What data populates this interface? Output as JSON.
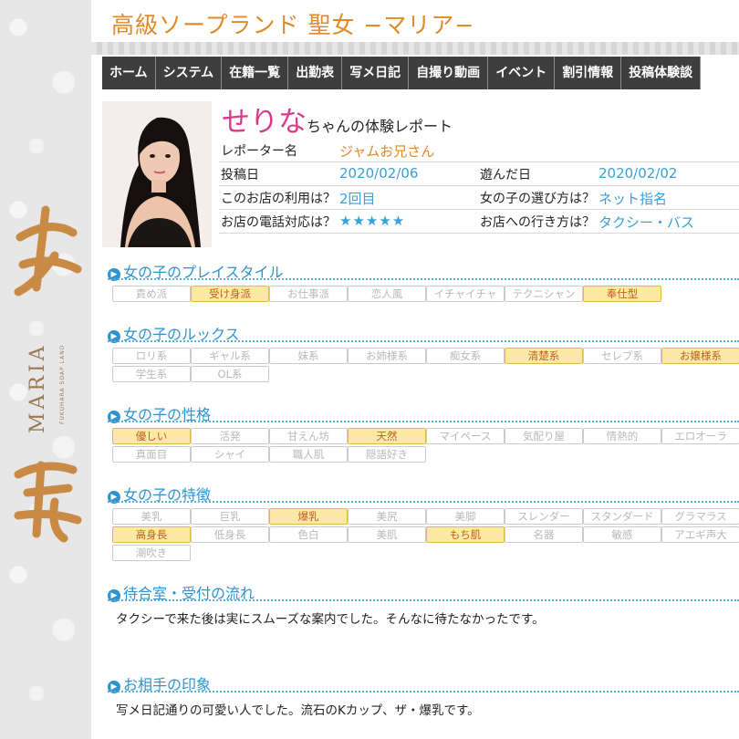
{
  "site": {
    "title": "高級ソープランド 聖女 −マリア−",
    "logo_text": "MARIA",
    "logo_subtext": "FUKUHARA SOAP LAND",
    "logo_kanji": "聖 女"
  },
  "nav": [
    "ホーム",
    "システム",
    "在籍一覧",
    "出勤表",
    "写メ日記",
    "自撮り動画",
    "イベント",
    "割引情報",
    "投稿体験談"
  ],
  "report": {
    "girl_name": "せりな",
    "name_suffix": "ちゃんの体験レポート",
    "reporter_label": "レポーター名",
    "reporter": "ジャムお兄さん",
    "posted_label": "投稿日",
    "posted": "2020/02/06",
    "played_label": "遊んだ日",
    "played": "2020/02/02",
    "usage_label": "このお店の利用は？",
    "usage": "2回目",
    "choice_label": "女の子の選び方は？",
    "choice": "ネット指名",
    "phone_label": "お店の電話対応は？",
    "phone": "★★★★★",
    "access_label": "お店への行き方は？",
    "access": "タクシー・バス"
  },
  "sections": [
    {
      "title": "女の子のプレイスタイル",
      "tags": [
        {
          "label": "責め派",
          "on": false
        },
        {
          "label": "受け身派",
          "on": true
        },
        {
          "label": "お仕事派",
          "on": false
        },
        {
          "label": "恋人風",
          "on": false
        },
        {
          "label": "イチャイチャ",
          "on": false
        },
        {
          "label": "テクニシャン",
          "on": false
        },
        {
          "label": "奉仕型",
          "on": true
        }
      ]
    },
    {
      "title": "女の子のルックス",
      "tags": [
        {
          "label": "ロリ系",
          "on": false
        },
        {
          "label": "ギャル系",
          "on": false
        },
        {
          "label": "妹系",
          "on": false
        },
        {
          "label": "お姉様系",
          "on": false
        },
        {
          "label": "痴女系",
          "on": false
        },
        {
          "label": "清楚系",
          "on": true
        },
        {
          "label": "セレブ系",
          "on": false
        },
        {
          "label": "お嬢様系",
          "on": true
        },
        {
          "label": "学生系",
          "on": false
        },
        {
          "label": "OL系",
          "on": false
        }
      ]
    },
    {
      "title": "女の子の性格",
      "tags": [
        {
          "label": "優しい",
          "on": true
        },
        {
          "label": "活発",
          "on": false
        },
        {
          "label": "甘えん坊",
          "on": false
        },
        {
          "label": "天然",
          "on": true
        },
        {
          "label": "マイペース",
          "on": false
        },
        {
          "label": "気配り屋",
          "on": false
        },
        {
          "label": "情熱的",
          "on": false
        },
        {
          "label": "エロオーラ",
          "on": false
        },
        {
          "label": "真面目",
          "on": false
        },
        {
          "label": "シャイ",
          "on": false
        },
        {
          "label": "職人肌",
          "on": false
        },
        {
          "label": "隠語好き",
          "on": false
        }
      ]
    },
    {
      "title": "女の子の特徴",
      "tags": [
        {
          "label": "美乳",
          "on": false
        },
        {
          "label": "巨乳",
          "on": false
        },
        {
          "label": "爆乳",
          "on": true
        },
        {
          "label": "美尻",
          "on": false
        },
        {
          "label": "美脚",
          "on": false
        },
        {
          "label": "スレンダー",
          "on": false
        },
        {
          "label": "スタンダード",
          "on": false
        },
        {
          "label": "グラマラス",
          "on": false
        },
        {
          "label": "高身長",
          "on": true
        },
        {
          "label": "低身長",
          "on": false
        },
        {
          "label": "色白",
          "on": false
        },
        {
          "label": "美肌",
          "on": false
        },
        {
          "label": "もち肌",
          "on": true
        },
        {
          "label": "名器",
          "on": false
        },
        {
          "label": "敏感",
          "on": false
        },
        {
          "label": "アエギ声大",
          "on": false
        },
        {
          "label": "潮吹き",
          "on": false
        }
      ]
    }
  ],
  "waiting": {
    "title": "待合室・受付の流れ",
    "text": "タクシーで来た後は実にスムーズな案内でした。そんなに待たなかったです。"
  },
  "impression": {
    "title": "お相手の印象",
    "text": "写メ日記通りの可愛い人でした。流石のKカップ、ザ・爆乳です。"
  }
}
